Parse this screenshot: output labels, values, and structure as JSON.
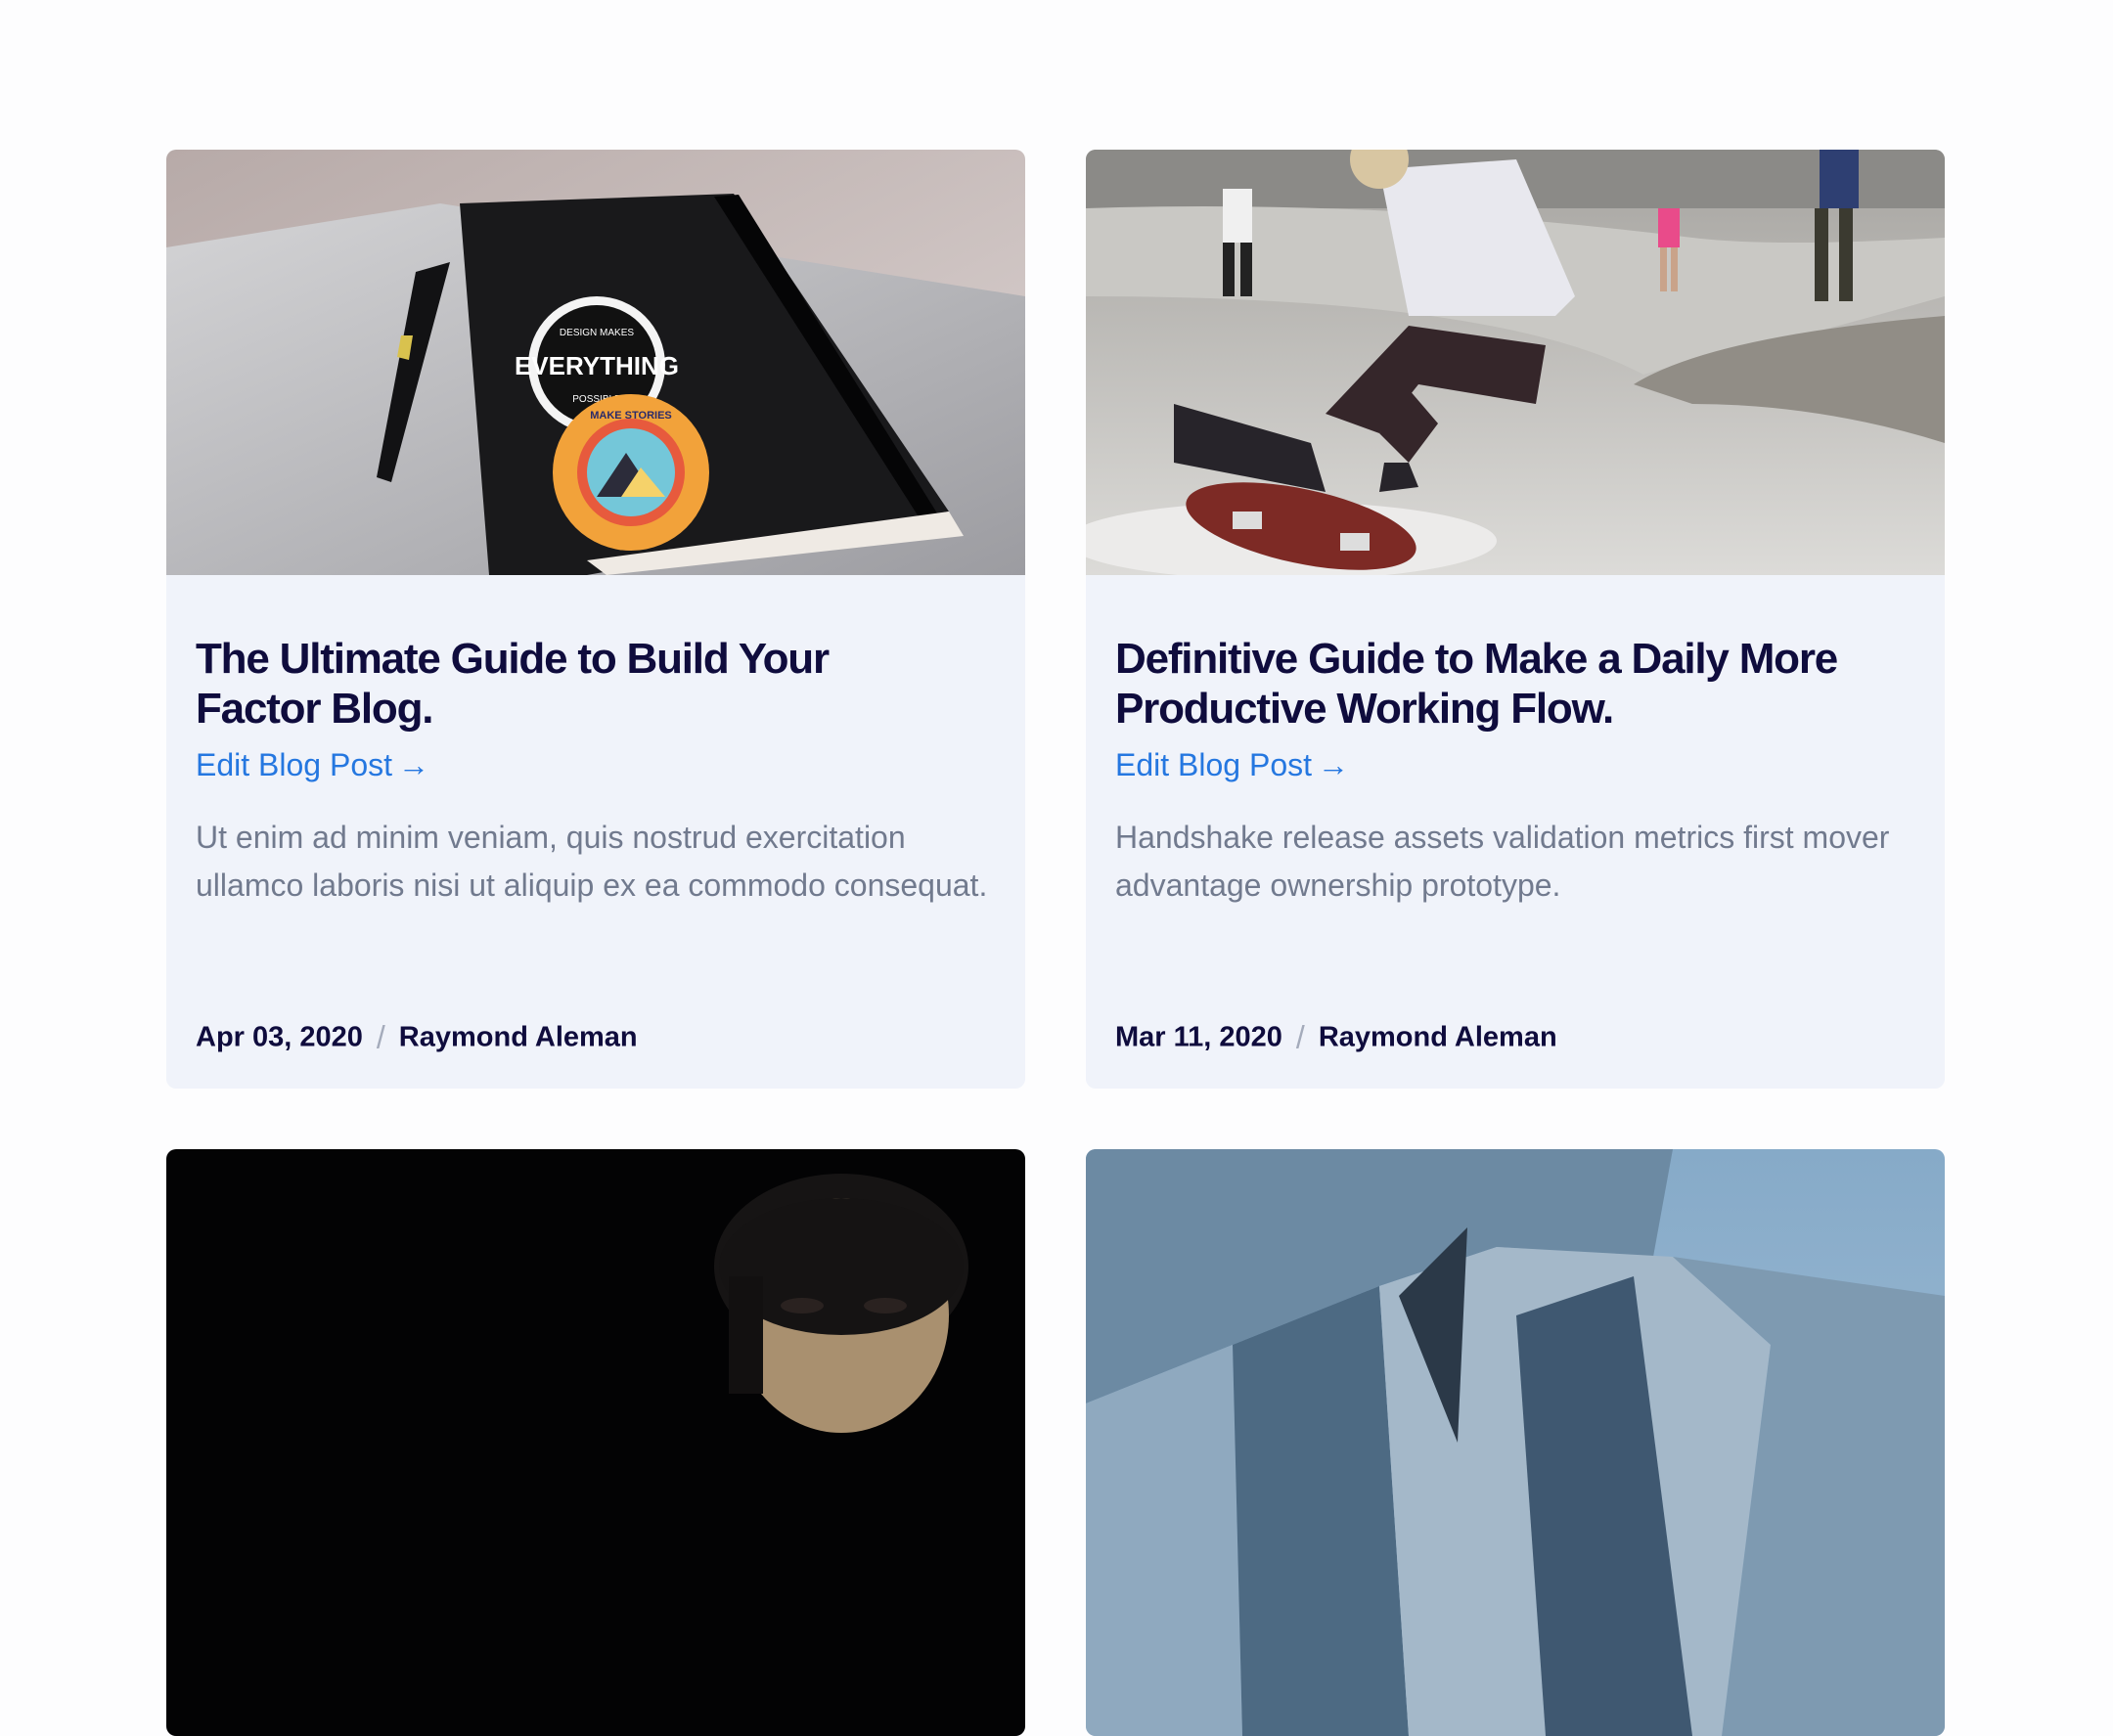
{
  "posts": [
    {
      "title_line1": "The Ultimate Guide to Build Your",
      "title_line2": "Factor Blog.",
      "edit_label": "Edit Blog Post",
      "edit_arrow": "→",
      "excerpt": "Ut enim ad minim veniam, quis nostrud exercitation ullamco laboris nisi ut aliquip ex ea commodo consequat.",
      "date": "Apr 03, 2020",
      "separator": "/",
      "author": "Raymond Aleman",
      "image": "notebook-with-pen-photo",
      "sticker_top": "EVERYTHING",
      "sticker_top_small_upper": "DESIGN MAKES",
      "sticker_top_small_lower": "POSSIBLE",
      "sticker_bottom_text": "MAKE STORIES"
    },
    {
      "title_line1": "Definitive Guide to Make a Daily More",
      "title_line2": "Productive Working Flow.",
      "edit_label": "Edit Blog Post",
      "edit_arrow": "→",
      "excerpt": "Handshake release assets validation metrics first mover advantage ownership prototype.",
      "date": "Mar 11, 2020",
      "separator": "/",
      "author": "Raymond Aleman",
      "image": "skateboarder-photo"
    },
    {
      "image": "martial-artist-portrait-photo"
    },
    {
      "image": "modern-architecture-photo"
    }
  ],
  "colors": {
    "card_bg": "#f0f3fa",
    "title": "#0f0c3d",
    "link": "#2577e0",
    "excerpt": "#717a8e"
  }
}
